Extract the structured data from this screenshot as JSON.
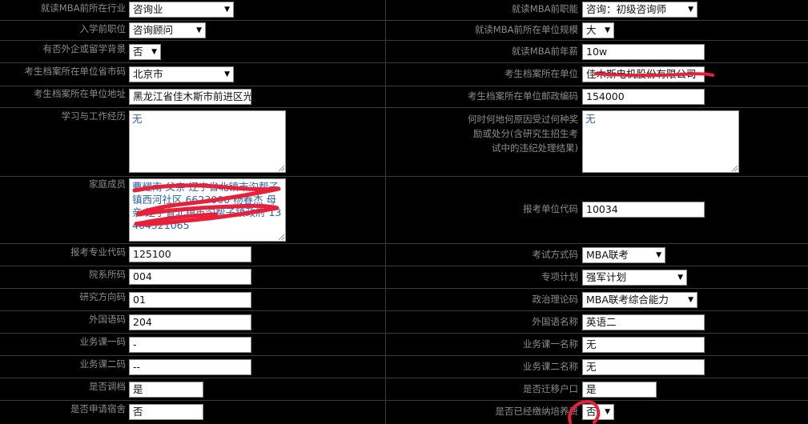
{
  "left": {
    "industry_label": "就读MBA前所在行业",
    "industry_value": "咨询业",
    "position_label": "入学前职位",
    "position_value": "咨询顾问",
    "foreign_label": "有否外企或留学背景",
    "foreign_value": "否",
    "archive_province_label": "考生档案所在单位省市码",
    "archive_province_value": "北京市",
    "archive_address_label": "考生档案所在单位地址",
    "archive_address_value": "黑龙江省佳木斯市前进区光",
    "experience_label": "学习与工作经历",
    "experience_value": "无",
    "family_label": "家庭成员",
    "family_value": "曹耀南  父亲  辽宁省北镇市沟帮子镇西河社区  6623000  杨春杰  母亲  辽宁省北镇市沟帮子镇政府  13464321065",
    "major_code_label": "报考专业代码",
    "major_code_value": "125100",
    "dept_label": "院系所码",
    "dept_value": "004",
    "direction_label": "研究方向码",
    "direction_value": "01",
    "foreign_lang_label": "外国语码",
    "foreign_lang_value": "204",
    "course1_label": "业务课一码",
    "course1_value": "-",
    "course2_label": "业务课二码",
    "course2_value": "--",
    "adjust_label": "是否调档",
    "adjust_value": "是",
    "dorm_label": "是否申请宿舍",
    "dorm_value": "否"
  },
  "right": {
    "function_label": "就读MBA前职能",
    "function_value": "咨询：初级咨询师",
    "scale_label": "就读MBA前所在单位规模",
    "scale_value": "大",
    "salary_label": "就读MBA前年薪",
    "salary_value": "10w",
    "archive_unit_label": "考生档案所在单位",
    "archive_unit_value": "佳木斯电机股份有限公司",
    "postcode_label": "考生档案所在单位邮政编码",
    "postcode_value": "154000",
    "punishment_label": "何时何地何原因受过何种奖励或处分(含研究生招生考试中的违纪处理结果)",
    "punishment_value": "无",
    "unit_code_label": "报考单位代码",
    "unit_code_value": "10034",
    "exam_method_label": "考试方式码",
    "exam_method_value": "MBA联考",
    "special_plan_label": "专项计划",
    "special_plan_value": "强军计划",
    "politics_label": "政治理论码",
    "politics_value": "MBA联考综合能力",
    "foreign_lang_name_label": "外国语名称",
    "foreign_lang_name_value": "英语二",
    "course1_name_label": "业务课一名称",
    "course1_name_value": "无",
    "course2_name_label": "业务课二名称",
    "course2_name_value": "无",
    "hukou_label": "是否迁移户口",
    "hukou_value": "是",
    "paid_label": "是否已经缴纳培养费",
    "paid_value": "否"
  },
  "colors": {
    "background": "#000000",
    "label": "#8c8c8c",
    "textarea_text": "#2a63a8",
    "scribble": "#e8203a"
  }
}
